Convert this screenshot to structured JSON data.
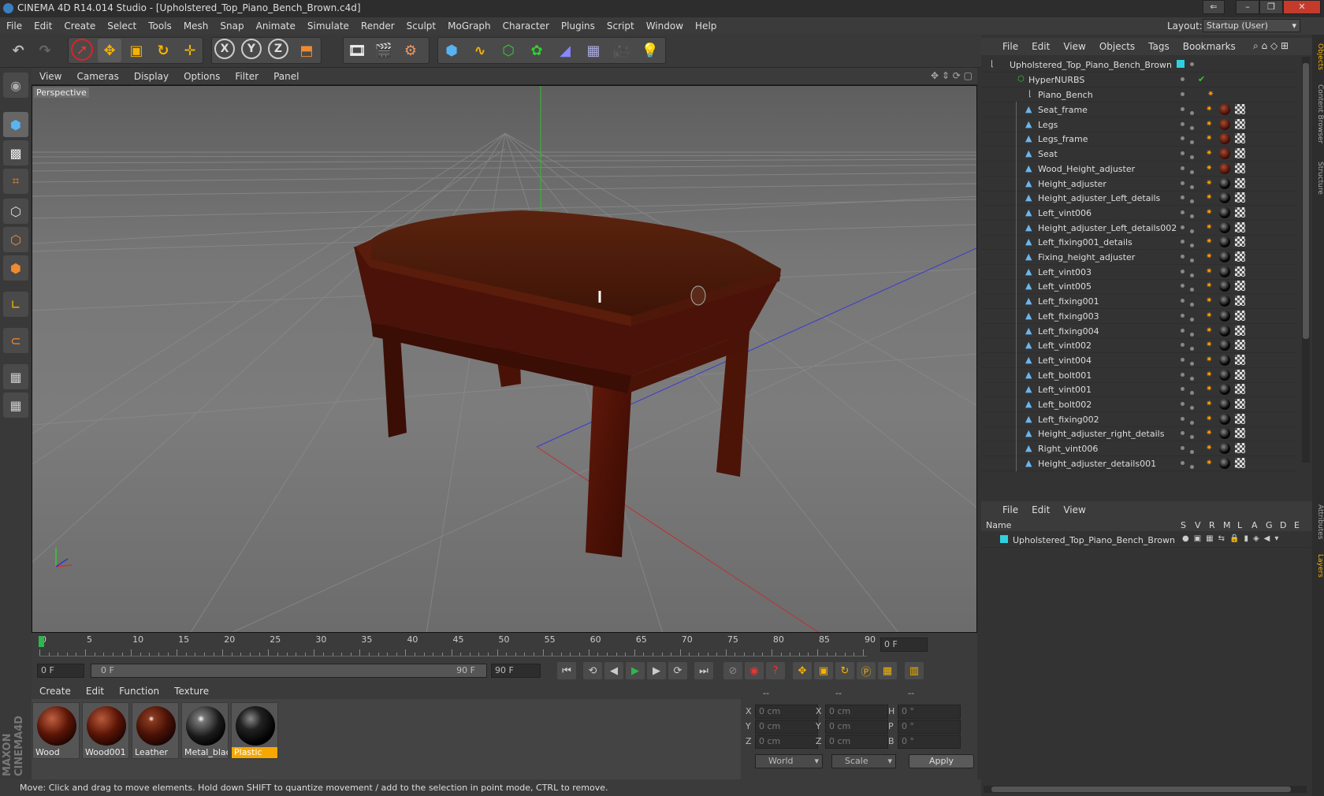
{
  "window": {
    "title": "CINEMA 4D R14.014 Studio - [Upholstered_Top_Piano_Bench_Brown.c4d]"
  },
  "menu": [
    "File",
    "Edit",
    "Create",
    "Select",
    "Tools",
    "Mesh",
    "Snap",
    "Animate",
    "Simulate",
    "Render",
    "Sculpt",
    "MoGraph",
    "Character",
    "Plugins",
    "Script",
    "Window",
    "Help"
  ],
  "layout": {
    "label": "Layout:",
    "value": "Startup (User)"
  },
  "viewport": {
    "menu": [
      "View",
      "Cameras",
      "Display",
      "Options",
      "Filter",
      "Panel"
    ],
    "label": "Perspective"
  },
  "timeline": {
    "ticks": [
      "0",
      "5",
      "10",
      "15",
      "20",
      "25",
      "30",
      "35",
      "40",
      "45",
      "50",
      "55",
      "60",
      "65",
      "70",
      "75",
      "80",
      "85",
      "90"
    ],
    "end_field": "0 F",
    "current": "0 F",
    "slider_start": "0 F",
    "slider_end": "90 F",
    "max": "90 F"
  },
  "materials": {
    "menu": [
      "Create",
      "Edit",
      "Function",
      "Texture"
    ],
    "items": [
      {
        "label": "Wood",
        "kind": "wood"
      },
      {
        "label": "Wood001",
        "kind": "wood"
      },
      {
        "label": "Leather",
        "kind": "leather"
      },
      {
        "label": "Metal_blac",
        "kind": "metal"
      },
      {
        "label": "Plastic",
        "kind": "plastic",
        "selected": true
      }
    ]
  },
  "coords": {
    "head": [
      "--",
      "--",
      "--"
    ],
    "rows": [
      {
        "a": "X",
        "av": "0 cm",
        "b": "X",
        "bv": "0 cm",
        "c": "H",
        "cv": "0 °"
      },
      {
        "a": "Y",
        "av": "0 cm",
        "b": "Y",
        "bv": "0 cm",
        "c": "P",
        "cv": "0 °"
      },
      {
        "a": "Z",
        "av": "0 cm",
        "b": "Z",
        "bv": "0 cm",
        "c": "B",
        "cv": "0 °"
      }
    ],
    "mode1": "World",
    "mode2": "Scale",
    "apply": "Apply"
  },
  "status": "Move: Click and drag to move elements. Hold down SHIFT to quantize movement / add to the selection in point mode, CTRL to remove.",
  "objects": {
    "menu": [
      "File",
      "Edit",
      "View",
      "Objects",
      "Tags",
      "Bookmarks"
    ],
    "root": "Upholstered_Top_Piano_Bench_Brown",
    "hypernurbs": "HyperNURBS",
    "group": "Piano_Bench",
    "items": [
      {
        "name": "Seat_frame",
        "tag": "wood"
      },
      {
        "name": "Legs",
        "tag": "wood"
      },
      {
        "name": "Legs_frame",
        "tag": "wood"
      },
      {
        "name": "Seat",
        "tag": "wood"
      },
      {
        "name": "Wood_Height_adjuster",
        "tag": "wood"
      },
      {
        "name": "Height_adjuster",
        "tag": "metal"
      },
      {
        "name": "Height_adjuster_Left_details",
        "tag": "metal"
      },
      {
        "name": "Left_vint006",
        "tag": "metal"
      },
      {
        "name": "Height_adjuster_Left_details002",
        "tag": "metal"
      },
      {
        "name": "Left_fixing001_details",
        "tag": "metal"
      },
      {
        "name": "Fixing_height_adjuster",
        "tag": "metal"
      },
      {
        "name": "Left_vint003",
        "tag": "metal"
      },
      {
        "name": "Left_vint005",
        "tag": "metal"
      },
      {
        "name": "Left_fixing001",
        "tag": "metal"
      },
      {
        "name": "Left_fixing003",
        "tag": "metal"
      },
      {
        "name": "Left_fixing004",
        "tag": "metal"
      },
      {
        "name": "Left_vint002",
        "tag": "metal"
      },
      {
        "name": "Left_vint004",
        "tag": "metal"
      },
      {
        "name": "Left_bolt001",
        "tag": "metal"
      },
      {
        "name": "Left_vint001",
        "tag": "metal"
      },
      {
        "name": "Left_bolt002",
        "tag": "metal"
      },
      {
        "name": "Left_fixing002",
        "tag": "metal"
      },
      {
        "name": "Height_adjuster_right_details",
        "tag": "metal"
      },
      {
        "name": "Right_vint006",
        "tag": "metal"
      },
      {
        "name": "Height_adjuster_details001",
        "tag": "metal"
      }
    ]
  },
  "layers": {
    "menu": [
      "File",
      "Edit",
      "View"
    ],
    "header_name": "Name",
    "header_cols": [
      "S",
      "V",
      "R",
      "M",
      "L",
      "A",
      "G",
      "D",
      "E"
    ],
    "row": "Upholstered_Top_Piano_Bench_Brown"
  },
  "side_tabs": [
    "Objects",
    "Content Browser",
    "Structure",
    "Attributes",
    "Layers"
  ]
}
